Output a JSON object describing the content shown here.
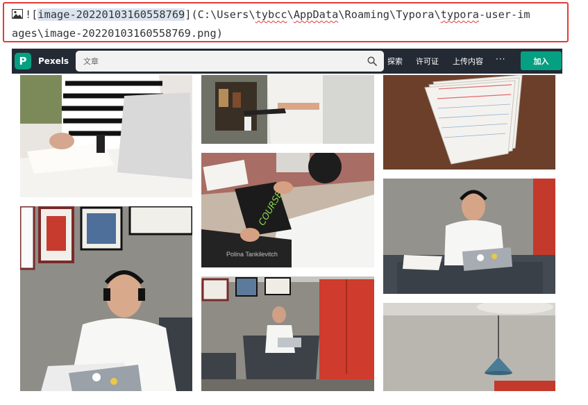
{
  "markdown_line": {
    "prefix": "![",
    "alt_text": "image-20220103160558769",
    "path_part1": "](C:\\Users\\",
    "path_user": "tybcc",
    "path_part2": "\\",
    "path_appdata": "AppData",
    "path_part3": "\\Roaming\\Typora\\",
    "path_typora": "typora",
    "path_part4": "-user-im",
    "line2": "ages\\image-20220103160558769.png)"
  },
  "header": {
    "brand": "Pexels",
    "logo_letter": "P",
    "search_value": "文章",
    "nav": [
      "探索",
      "许可证",
      "上传内容"
    ],
    "more": "···",
    "join": "加入"
  },
  "photos": {
    "credit_text": "Polina Tankilevitch"
  },
  "colors": {
    "accent": "#05a081",
    "header_bg": "#232a34",
    "highlight_border": "#e53935"
  }
}
